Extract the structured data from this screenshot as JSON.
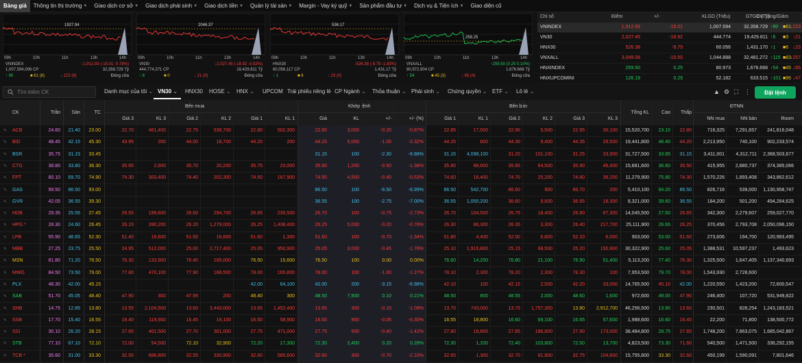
{
  "nav": [
    {
      "label": "Bảng giá",
      "active": true,
      "caret": false
    },
    {
      "label": "Thông tin thị trường",
      "caret": true
    },
    {
      "label": "Giao dịch cơ sở",
      "caret": true
    },
    {
      "label": "Giao dịch phái sinh",
      "caret": true
    },
    {
      "label": "Giao dịch tiền",
      "caret": true
    },
    {
      "label": "Quản lý tài sản",
      "caret": true
    },
    {
      "label": "Margin - Vay ký quỹ",
      "caret": true
    },
    {
      "label": "Sản phẩm đầu tư",
      "caret": true
    },
    {
      "label": "Dịch vụ & Tiện ích",
      "caret": true
    },
    {
      "label": "Giao diện cũ",
      "caret": false
    }
  ],
  "colors": {
    "up": "#1fd05b",
    "down": "#ff3b3b",
    "ref": "#e8c020",
    "ceil": "#f57cf1",
    "floor": "#44c1e8",
    "accent": "#0fa45d"
  },
  "minicharts": [
    {
      "name": "VNINDEX",
      "level": "1927.94",
      "change": "↓1,912.93 (-15.01 -0.78%)",
      "volume": "1,007,594,006 CP",
      "value": "32,358.729 Tỷ",
      "up": "90",
      "ref": "61",
      "down": "223",
      "refcount": "(8)",
      "downcount": "(8)",
      "status": "Đóng cửa",
      "trend": "down",
      "times": [
        "09h",
        "10h",
        "11h",
        "13h",
        "14h"
      ]
    },
    {
      "name": "VN30",
      "level": "2046.37",
      "change": "↓2,027.45 (-18.92 -0.92%)",
      "volume": "444,774,371 CP",
      "value": "19,429.811 Tỷ",
      "up": "6",
      "ref": "0",
      "down": "21",
      "refcount": "",
      "downcount": "(0)",
      "status": "Đóng cửa",
      "trend": "down",
      "times": [
        "09h",
        "10h",
        "11h",
        "13h",
        "14h"
      ]
    },
    {
      "name": "HNX30",
      "level": "536.17",
      "change": "↓526.38 (-9.79 -1.83%)",
      "volume": "60,056,117 CP",
      "value": "1,431.17 Tỷ",
      "up": "1",
      "ref": "6",
      "down": "23",
      "refcount": "",
      "downcount": "(0)",
      "status": "Đóng cửa",
      "trend": "down",
      "times": [
        "09h",
        "10h",
        "11h",
        "13h",
        "14h"
      ]
    },
    {
      "name": "VNXALL",
      "level": "259.25",
      "change": "↑259.50 (0.25 0.10%)",
      "volume": "80,972,904 CP",
      "value": "1,676.668 Tỷ",
      "up": "54",
      "ref": "45",
      "down": "65",
      "refcount": "(3)",
      "downcount": "(4)",
      "status": "Đóng cửa",
      "trend": "up",
      "times": [
        "09h",
        "10h",
        "11h",
        "13h",
        "14h"
      ]
    }
  ],
  "indices": {
    "headers": [
      "Chỉ số",
      "Điểm",
      "+/-",
      "KLGD (Triệu)",
      "GTGD (Tỷ)",
      "CK Tăng/Giảm"
    ],
    "rows": [
      {
        "name": "VNINDEX",
        "point": "1,912.93",
        "chg": "-15.01",
        "vol": "1,007.594",
        "val": "32,358.729",
        "up": "90",
        "ref": "61",
        "down": "223",
        "dir": "down"
      },
      {
        "name": "VN30",
        "point": "2,027.45",
        "chg": "-18.92",
        "vol": "444.774",
        "val": "19,429.811",
        "up": "6",
        "ref": "3",
        "down": "21",
        "dir": "down"
      },
      {
        "name": "HNX30",
        "point": "526.38",
        "chg": "-9.79",
        "vol": "60.056",
        "val": "1,431.170",
        "up": "1",
        "ref": "6",
        "down": "23",
        "dir": "down"
      },
      {
        "name": "VNXALL",
        "point": "3,049.58",
        "chg": "-19.50",
        "vol": "1,044.888",
        "val": "32,481.272",
        "up": "115",
        "ref": "83",
        "down": "257",
        "dir": "down"
      },
      {
        "name": "HNXINDEX",
        "point": "259.50",
        "chg": "0.25",
        "vol": "80.973",
        "val": "1,676.668",
        "up": "54",
        "ref": "45",
        "down": "65",
        "dir": "up"
      },
      {
        "name": "HNXUPCOMINI",
        "point": "126.19",
        "chg": "0.29",
        "vol": "52.182",
        "val": "633.515",
        "up": "101",
        "ref": "96",
        "down": "47",
        "dir": "up"
      }
    ]
  },
  "toolbar": {
    "search_placeholder": "Tìm kiếm CK",
    "tabs": [
      {
        "label": "Danh mục của tôi",
        "caret": true
      },
      {
        "label": "VN30",
        "caret": true,
        "active": true
      },
      {
        "label": "HNX30",
        "caret": false
      },
      {
        "label": "HOSE",
        "caret": true
      },
      {
        "label": "HNX",
        "caret": true
      },
      {
        "label": "UPCOM",
        "caret": false
      },
      {
        "label": "Trái phiếu riêng lẻ",
        "caret": false
      },
      {
        "label": "CP Ngành",
        "caret": true
      },
      {
        "label": "Thỏa thuận",
        "caret": true
      },
      {
        "label": "Phái sinh",
        "caret": true
      },
      {
        "label": "Chứng quyền",
        "caret": true
      },
      {
        "label": "ETF",
        "caret": true
      },
      {
        "label": "Lô lẻ",
        "caret": true
      }
    ],
    "order_label": "Đặt lệnh"
  },
  "table": {
    "groups": {
      "buy": "Bên mua",
      "match": "Khớp lệnh",
      "sell": "Bên bán",
      "foreign": "ĐTNN"
    },
    "headers": {
      "ck": "CK",
      "ceil": "Trần",
      "floor": "Sàn",
      "ref": "TC",
      "bp3": "Giá 3",
      "bv3": "KL 3",
      "bp2": "Giá 2",
      "bv2": "KL 2",
      "bp1": "Giá 1",
      "bv1": "KL 1",
      "mp": "Giá",
      "mv": "KL",
      "mc": "+/-",
      "mpct": "+/- (%)",
      "sp1": "Giá 1",
      "sv1": "KL 1",
      "sp2": "Giá 2",
      "sv2": "KL 2",
      "sp3": "Giá 3",
      "sv3": "KL 3",
      "tot": "Tổng KL",
      "hi": "Cao",
      "lo": "Thấp",
      "fb": "NN mua",
      "fs": "NN bán",
      "room": "Room"
    },
    "rows": [
      {
        "s": "ACB",
        "c": "24.60",
        "f": "21.40",
        "r": "23.00",
        "b3": "22.70",
        "bv3": "461,400",
        "b2": "22.75",
        "bv2": "539,700",
        "b1": "22.80",
        "bv1": "502,300",
        "m": "22.80",
        "mv": "3,000",
        "mc": "-0.20",
        "mp": "-0.87%",
        "s1": "22.85",
        "sv1": "17,500",
        "s2": "22.90",
        "sv2": "5,500",
        "s3": "22.95",
        "sv3": "30,100",
        "t": "15,520,700",
        "h": "23.10",
        "l": "22.80",
        "nb": "716,325",
        "ns": "7,291,657",
        "rm": "241,816,048",
        "d": "down"
      },
      {
        "s": "BID",
        "c": "48.45",
        "f": "42.15",
        "r": "45.30",
        "b3": "43.95",
        "bv3": "200",
        "b2": "44.00",
        "bv2": "18,700",
        "b1": "44.20",
        "bv1": "200",
        "m": "44.25",
        "mv": "5,000",
        "mc": "-1.05",
        "mp": "-2.32%",
        "s1": "44.25",
        "sv1": "600",
        "s2": "44.30",
        "sv2": "9,400",
        "s3": "44.35",
        "sv3": "29,500",
        "t": "19,441,800",
        "h": "46.40",
        "l": "44.20",
        "nb": "2,213,950",
        "ns": "740,100",
        "rm": "902,233,574",
        "d": "down"
      },
      {
        "s": "BSR",
        "c": "35.75",
        "f": "31.15",
        "r": "33.45",
        "b3": "",
        "bv3": "",
        "b2": "",
        "bv2": "",
        "b1": "",
        "bv1": "",
        "m": "31.15",
        "mv": "100",
        "mc": "-2.30",
        "mp": "-6.88%",
        "s1": "31.15",
        "sv1": "4,098,100",
        "s2": "31.20",
        "sv2": "101,100",
        "s3": "31.25",
        "sv3": "33,900",
        "t": "31,727,500",
        "h": "33.85",
        "l": "31.15",
        "nb": "3,411,001",
        "ns": "4,312,711",
        "rm": "2,368,503,677",
        "d": "floor"
      },
      {
        "s": "CTG",
        "c": "38.80",
        "f": "33.80",
        "r": "36.30",
        "b3": "35.65",
        "bv3": "2,900",
        "b2": "35.70",
        "bv2": "20,200",
        "b1": "35.75",
        "bv1": "23,000",
        "m": "35.80",
        "mv": "1,200",
        "mc": "-0.50",
        "mp": "-1.38%",
        "s1": "35.80",
        "sv1": "88,600",
        "s2": "35.85",
        "sv2": "64,500",
        "s3": "35.90",
        "sv3": "45,400",
        "t": "15,681,600",
        "h": "36.60",
        "l": "35.50",
        "nb": "415,955",
        "ns": "2,880,737",
        "rm": "374,385,066",
        "d": "down"
      },
      {
        "s": "FPT",
        "c": "80.10",
        "f": "69.70",
        "r": "74.90",
        "b3": "74.30",
        "bv3": "303,400",
        "b2": "74.40",
        "bv2": "202,300",
        "b1": "74.50",
        "bv1": "167,900",
        "m": "74.50",
        "mv": "4,500",
        "mc": "-0.40",
        "mp": "-0.53%",
        "s1": "74.60",
        "sv1": "16,400",
        "s2": "74.70",
        "sv2": "25,200",
        "s3": "74.80",
        "sv3": "36,200",
        "t": "11,279,900",
        "h": "75.80",
        "l": "74.30",
        "nb": "1,570,226",
        "ns": "1,893,408",
        "rm": "343,862,612",
        "d": "down"
      },
      {
        "s": "GAS",
        "c": "99.50",
        "f": "86.50",
        "r": "93.00",
        "b3": "",
        "bv3": "",
        "b2": "",
        "bv2": "",
        "b1": "",
        "bv1": "",
        "m": "86.50",
        "mv": "100",
        "mc": "-6.50",
        "mp": "-6.99%",
        "s1": "86.50",
        "sv1": "542,700",
        "s2": "86.60",
        "sv2": "900",
        "s3": "86.70",
        "sv3": "200",
        "t": "5,410,100",
        "h": "94.20",
        "l": "86.50",
        "nb": "826,716",
        "ns": "539,000",
        "rm": "1,130,958,747",
        "d": "floor"
      },
      {
        "s": "GVR",
        "c": "42.05",
        "f": "36.55",
        "r": "39.30",
        "b3": "",
        "bv3": "",
        "b2": "",
        "bv2": "",
        "b1": "",
        "bv1": "",
        "m": "36.55",
        "mv": "100",
        "mc": "-2.75",
        "mp": "-7.00%",
        "s1": "36.55",
        "sv1": "1,050,200",
        "s2": "36.60",
        "sv2": "9,600",
        "s3": "36.65",
        "sv3": "18,300",
        "t": "8,321,000",
        "h": "39.60",
        "l": "36.55",
        "nb": "184,200",
        "ns": "501,200",
        "rm": "494,264,625",
        "d": "floor"
      },
      {
        "s": "HDB",
        "c": "29.35",
        "f": "25.55",
        "r": "27.45",
        "b3": "26.55",
        "bv3": "199,600",
        "b2": "26.60",
        "bv2": "294,700",
        "b1": "26.65",
        "bv1": "235,500",
        "m": "26.70",
        "mv": "100",
        "mc": "-0.75",
        "mp": "-2.73%",
        "s1": "26.70",
        "sv1": "104,500",
        "s2": "26.75",
        "sv2": "18,400",
        "s3": "26.80",
        "sv3": "67,300",
        "t": "14,045,500",
        "h": "27.50",
        "l": "26.65",
        "nb": "342,300",
        "ns": "2,279,607",
        "rm": "259,027,770",
        "d": "down"
      },
      {
        "s": "HPG *",
        "c": "28.30",
        "f": "24.60",
        "r": "26.45",
        "b3": "26.15",
        "bv3": "280,200",
        "b2": "26.20",
        "bv2": "1,279,000",
        "b1": "26.25",
        "bv1": "1,438,400",
        "m": "26.25",
        "mv": "5,000",
        "mc": "-0.20",
        "mp": "-0.76%",
        "s1": "26.30",
        "sv1": "86,300",
        "s2": "26.35",
        "sv2": "3,300",
        "s3": "26.40",
        "sv3": "217,700",
        "t": "25,111,900",
        "h": "26.65",
        "l": "26.25",
        "nb": "370,456",
        "ns": "2,793,708",
        "rm": "2,050,096,150",
        "d": "down"
      },
      {
        "s": "LPB",
        "c": "55.90",
        "f": "48.65",
        "r": "52.30",
        "b3": "51.40",
        "bv3": "16,600",
        "b2": "51.50",
        "bv2": "16,600",
        "b1": "51.60",
        "bv1": "1,300",
        "m": "51.60",
        "mv": "100",
        "mc": "-0.70",
        "mp": "-1.34%",
        "s1": "51.80",
        "sv1": "4,400",
        "s2": "52.00",
        "sv2": "6,800",
        "s3": "52.10",
        "sv3": "6,000",
        "t": "903,000",
        "h": "53.00",
        "l": "51.60",
        "nb": "273,606",
        "ns": "194,700",
        "rm": "120,983,495",
        "d": "down"
      },
      {
        "s": "MBB",
        "c": "27.25",
        "f": "23.75",
        "r": "25.50",
        "b3": "24.95",
        "bv3": "512,000",
        "b2": "25.00",
        "bv2": "2,717,400",
        "b1": "25.05",
        "bv1": "950,900",
        "m": "25.05",
        "mv": "3,000",
        "mc": "-0.45",
        "mp": "-1.76%",
        "s1": "25.10",
        "sv1": "1,915,800",
        "s2": "25.15",
        "sv2": "68,500",
        "s3": "25.20",
        "sv3": "150,900",
        "t": "30,322,900",
        "h": "25.60",
        "l": "25.05",
        "nb": "1,388,531",
        "ns": "10,597,237",
        "rm": "1,493,623",
        "d": "down"
      },
      {
        "s": "MSN",
        "c": "81.80",
        "f": "71.20",
        "r": "76.50",
        "b3": "76.30",
        "bv3": "133,900",
        "b2": "76.40",
        "bv2": "165,000",
        "b1": "76.50",
        "bv1": "15,600",
        "m": "76.50",
        "mv": "100",
        "mc": "0.00",
        "mp": "0.00%",
        "s1": "76.60",
        "sv1": "14,200",
        "s2": "76.80",
        "sv2": "21,100",
        "s3": "76.90",
        "sv3": "51,400",
        "t": "5,113,200",
        "h": "77.40",
        "l": "76.30",
        "nb": "1,325,500",
        "ns": "1,647,405",
        "rm": "1,137,340,693",
        "d": "ref"
      },
      {
        "s": "MWG",
        "c": "84.50",
        "f": "73.50",
        "r": "79.00",
        "b3": "77.80",
        "bv3": "470,100",
        "b2": "77.90",
        "bv2": "168,500",
        "b1": "78.00",
        "bv1": "165,800",
        "m": "78.00",
        "mv": "100",
        "mc": "-1.00",
        "mp": "-1.27%",
        "s1": "78.10",
        "sv1": "2,300",
        "s2": "78.20",
        "sv2": "2,300",
        "s3": "78.30",
        "sv3": "100",
        "t": "7,953,500",
        "h": "79.70",
        "l": "78.00",
        "nb": "1,543,930",
        "ns": "2,728,600",
        "rm": "",
        "d": "down"
      },
      {
        "s": "PLX",
        "c": "48.30",
        "f": "42.00",
        "r": "45.15",
        "b3": "",
        "bv3": "",
        "b2": "",
        "bv2": "",
        "b1": "42.00",
        "bv1": "64,100",
        "m": "42.00",
        "mv": "200",
        "mc": "-3.15",
        "mp": "-6.98%",
        "s1": "42.10",
        "sv1": "100",
        "s2": "42.15",
        "sv2": "2,500",
        "s3": "42.20",
        "sv3": "33,000",
        "t": "14,765,500",
        "h": "45.10",
        "l": "42.00",
        "nb": "1,220,550",
        "ns": "1,423,200",
        "rm": "72,600,547",
        "d": "floor"
      },
      {
        "s": "SAB",
        "c": "51.70",
        "f": "45.05",
        "r": "48.40",
        "b3": "47.90",
        "bv3": "300",
        "b2": "47.95",
        "bv2": "200",
        "b1": "48.40",
        "bv1": "300",
        "m": "48.50",
        "mv": "7,900",
        "mc": "0.10",
        "mp": "0.21%",
        "s1": "48.50",
        "sv1": "800",
        "s2": "48.55",
        "sv2": "2,000",
        "s3": "48.60",
        "sv3": "1,600",
        "t": "972,600",
        "h": "49.00",
        "l": "47.90",
        "nb": "246,400",
        "ns": "107,720",
        "rm": "531,949,822",
        "d": "up"
      },
      {
        "s": "SHB",
        "c": "14.75",
        "f": "12.85",
        "r": "13.80",
        "b3": "13.55",
        "bv3": "2,104,500",
        "b2": "13.60",
        "bv2": "3,443,000",
        "b1": "13.65",
        "bv1": "1,452,400",
        "m": "13.65",
        "mv": "300",
        "mc": "-0.15",
        "mp": "-1.09%",
        "s1": "13.70",
        "sv1": "743,000",
        "s2": "13.75",
        "sv2": "1,757,300",
        "s3": "13.80",
        "sv3": "2,912,700",
        "t": "46,256,500",
        "h": "13.90",
        "l": "13.60",
        "nb": "230,501",
        "ns": "828,254",
        "rm": "1,243,183,521",
        "d": "down"
      },
      {
        "s": "SSB",
        "c": "17.70",
        "f": "15.40",
        "r": "16.55",
        "b3": "16.40",
        "bv3": "119,900",
        "b2": "16.45",
        "bv2": "19,100",
        "b1": "16.50",
        "bv1": "58,900",
        "m": "16.50",
        "mv": "900",
        "mc": "-0.05",
        "mp": "-0.30%",
        "s1": "16.55",
        "sv1": "18,800",
        "s2": "16.60",
        "sv2": "69,100",
        "s3": "16.65",
        "sv3": "57,600",
        "t": "1,988,600",
        "h": "16.60",
        "l": "16.40",
        "nb": "22,200",
        "ns": "71,800",
        "rm": "138,500,772",
        "d": "down"
      },
      {
        "s": "SSI",
        "c": "30.10",
        "f": "26.20",
        "r": "28.15",
        "b3": "27.65",
        "bv3": "401,500",
        "b2": "27.70",
        "bv2": "361,000",
        "b1": "27.75",
        "bv1": "471,000",
        "m": "27.75",
        "mv": "500",
        "mc": "-0.40",
        "mp": "-1.42%",
        "s1": "27.80",
        "sv1": "16,800",
        "s2": "27.85",
        "sv2": "186,800",
        "s3": "27.90",
        "sv3": "173,000",
        "t": "38,484,800",
        "h": "28.75",
        "l": "27.65",
        "nb": "1,748,200",
        "ns": "7,863,075",
        "rm": "1,685,042,867",
        "d": "down"
      },
      {
        "s": "STB",
        "c": "77.10",
        "f": "67.10",
        "r": "72.10",
        "b3": "72.00",
        "bv3": "54,500",
        "b2": "72.10",
        "bv2": "32,900",
        "b1": "72.20",
        "bv1": "17,300",
        "m": "72.30",
        "mv": "2,400",
        "mc": "0.20",
        "mp": "0.28%",
        "s1": "72.30",
        "sv1": "1,200",
        "s2": "72.40",
        "sv2": "103,800",
        "s3": "72.50",
        "sv3": "13,700",
        "t": "4,823,500",
        "h": "73.30",
        "l": "71.60",
        "nb": "540,500",
        "ns": "1,471,500",
        "rm": "336,292,155",
        "d": "up"
      },
      {
        "s": "TCB *",
        "c": "35.60",
        "f": "31.00",
        "r": "33.30",
        "b3": "32.50",
        "bv3": "686,800",
        "b2": "32.55",
        "bv2": "330,900",
        "b1": "32.60",
        "bv1": "585,600",
        "m": "32.60",
        "mv": "300",
        "mc": "-0.70",
        "mp": "-2.10%",
        "s1": "32.65",
        "sv1": "1,300",
        "s2": "32.70",
        "sv2": "81,900",
        "s3": "32.75",
        "sv3": "104,800",
        "t": "15,755,800",
        "h": "33.30",
        "l": "32.60",
        "nb": "450,199",
        "ns": "1,590,091",
        "rm": "7,801,646",
        "d": "down"
      }
    ]
  }
}
